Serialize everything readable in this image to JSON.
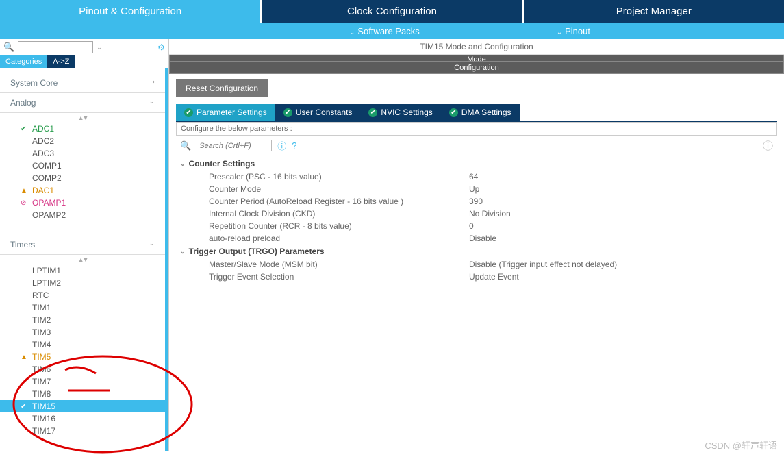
{
  "top_tabs": {
    "t0": "Pinout & Configuration",
    "t1": "Clock Configuration",
    "t2": "Project Manager"
  },
  "sub_header": {
    "software_packs": "Software Packs",
    "pinout": "Pinout"
  },
  "sidebar": {
    "search_placeholder": "",
    "cat_tab": "Categories",
    "az_tab": "A->Z",
    "sections": {
      "system_core": "System Core",
      "analog": "Analog",
      "timers": "Timers"
    },
    "analog_items": {
      "i0": "ADC1",
      "i1": "ADC2",
      "i2": "ADC3",
      "i3": "COMP1",
      "i4": "COMP2",
      "i5": "DAC1",
      "i6": "OPAMP1",
      "i7": "OPAMP2"
    },
    "timer_items": {
      "i0": "LPTIM1",
      "i1": "LPTIM2",
      "i2": "RTC",
      "i3": "TIM1",
      "i4": "TIM2",
      "i5": "TIM3",
      "i6": "TIM4",
      "i7": "TIM5",
      "i8": "TIM6",
      "i9": "TIM7",
      "i10": "TIM8",
      "i11": "TIM15",
      "i12": "TIM16",
      "i13": "TIM17"
    }
  },
  "main": {
    "title": "TIM15 Mode and Configuration",
    "mode_hdr": "Mode",
    "config_hdr": "Configuration",
    "reset_btn": "Reset Configuration",
    "param_tabs": {
      "t0": "Parameter Settings",
      "t1": "User Constants",
      "t2": "NVIC Settings",
      "t3": "DMA Settings"
    },
    "below": "Configure the below parameters :",
    "search_placeholder": "Search (Crtl+F)",
    "group_counter": "Counter Settings",
    "group_trgo": "Trigger Output (TRGO) Parameters",
    "rows": {
      "r0k": "Prescaler (PSC - 16 bits value)",
      "r0v": "64",
      "r1k": "Counter Mode",
      "r1v": "Up",
      "r2k": "Counter Period (AutoReload Register - 16 bits value )",
      "r2v": "390",
      "r3k": "Internal Clock Division (CKD)",
      "r3v": "No Division",
      "r4k": "Repetition Counter (RCR - 8 bits value)",
      "r4v": "0",
      "r5k": "auto-reload preload",
      "r5v": "Disable",
      "r6k": "Master/Slave Mode (MSM bit)",
      "r6v": "Disable (Trigger input effect not delayed)",
      "r7k": "Trigger Event Selection",
      "r7v": "Update Event"
    }
  },
  "watermark": "CSDN @轩声轩语"
}
